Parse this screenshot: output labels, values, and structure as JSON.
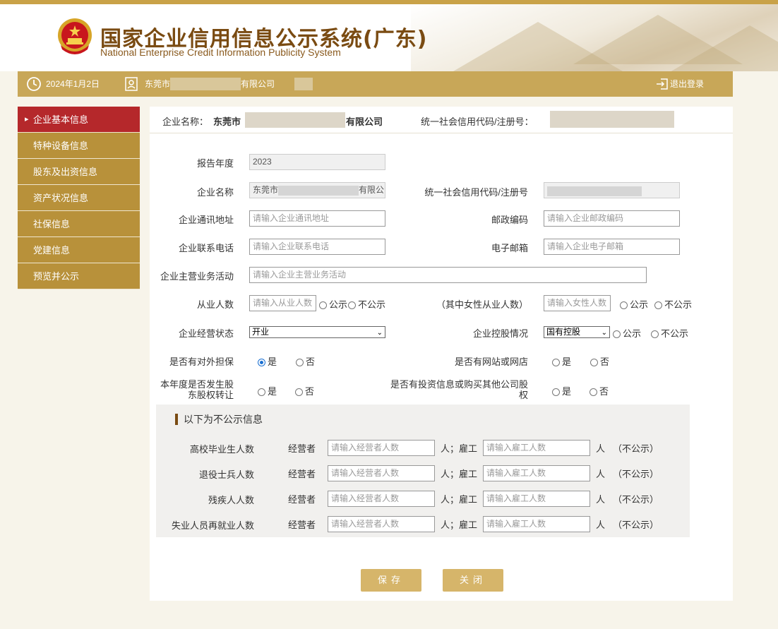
{
  "header": {
    "title": "国家企业信用信息公示系统(广东)",
    "subtitle": "National Enterprise Credit Information Publicity System"
  },
  "infobar": {
    "date": "2024年1月2日",
    "company_prefix": "东莞市",
    "company_suffix": "有限公司",
    "logout": "退出登录"
  },
  "sidebar": {
    "items": [
      {
        "label": "企业基本信息",
        "active": true
      },
      {
        "label": "特种设备信息"
      },
      {
        "label": "股东及出资信息"
      },
      {
        "label": "资产状况信息"
      },
      {
        "label": "社保信息"
      },
      {
        "label": "党建信息"
      },
      {
        "label": "预览并公示"
      }
    ]
  },
  "panel_head": {
    "name_label": "企业名称：",
    "name_prefix": "东莞市",
    "name_suffix": "有限公司",
    "code_label": "统一社会信用代码/注册号："
  },
  "form": {
    "report_year_label": "报告年度",
    "report_year_value": "2023",
    "company_name_label": "企业名称",
    "company_name_prefix": "东莞市",
    "company_name_suffix": "有限公",
    "credit_code_label": "统一社会信用代码/注册号",
    "address_label": "企业通讯地址",
    "address_placeholder": "请输入企业通讯地址",
    "postcode_label": "邮政编码",
    "postcode_placeholder": "请输入企业邮政编码",
    "phone_label": "企业联系电话",
    "phone_placeholder": "请输入企业联系电话",
    "email_label": "电子邮箱",
    "email_placeholder": "请输入企业电子邮箱",
    "business_label": "企业主营业务活动",
    "business_placeholder": "请输入企业主营业务活动",
    "employees_label": "从业人数",
    "employees_placeholder": "请输入从业人数",
    "female_label": "（其中女性从业人数）",
    "female_placeholder": "请输入女性人数",
    "public": "公示",
    "not_public": "不公示",
    "status_label": "企业经营状态",
    "status_value": "开业",
    "holding_label": "企业控股情况",
    "holding_value": "国有控股",
    "guarantee_label": "是否有对外担保",
    "website_label": "是否有网站或网店",
    "equity_transfer_label_1": "本年度是否发生股",
    "equity_transfer_label_2": "东股权转让",
    "invest_label_1": "是否有投资信息或购买其他公司股",
    "invest_label_2": "权",
    "yes": "是",
    "no": "否"
  },
  "nonpublic": {
    "title": "以下为不公示信息",
    "operator_label": "经营者",
    "employee_label": "人；雇工",
    "unit": "人",
    "tag": "（不公示）",
    "operator_placeholder": "请输入经营者人数",
    "employee_placeholder": "请输入雇工人数",
    "rows": [
      {
        "label": "高校毕业生人数"
      },
      {
        "label": "退役士兵人数"
      },
      {
        "label": "残疾人人数"
      },
      {
        "label": "失业人员再就业人数"
      }
    ]
  },
  "buttons": {
    "save": "保存",
    "close": "关闭"
  }
}
